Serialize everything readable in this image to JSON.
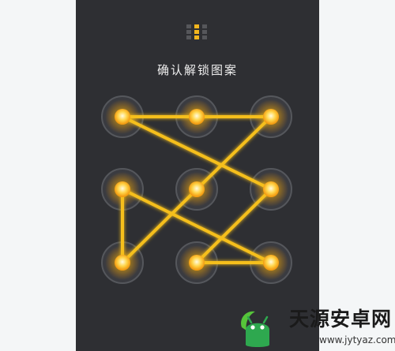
{
  "screen": {
    "title": "确认解锁图案"
  },
  "pattern_preview": {
    "cells": [
      [
        0,
        1,
        0
      ],
      [
        0,
        1,
        0
      ],
      [
        0,
        1,
        0
      ]
    ]
  },
  "lock_pattern": {
    "nodes": [
      1,
      2,
      3,
      4,
      5,
      6,
      7,
      8,
      9
    ],
    "sequence": [
      1,
      2,
      3,
      5,
      7,
      4,
      9,
      8,
      6,
      1
    ],
    "colors": {
      "line": "#f5bf1e",
      "node_core": "#fff3b0",
      "node_glow": "#ffb300",
      "ring": "#55575c",
      "ring_fill": "#3a3b40"
    }
  },
  "watermark": {
    "title": "天源安卓网",
    "url": "www.jytyaz.com",
    "icon": "android-robot-icon",
    "colors": {
      "green": "#2ea84f",
      "leaf": "#56c43a"
    }
  }
}
